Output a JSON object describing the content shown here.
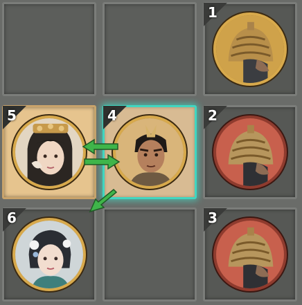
{
  "board": {
    "slots": [
      {
        "number": "1",
        "unit": "helmeted-soldier",
        "frame": "gold"
      },
      {
        "number": "2",
        "unit": "helmeted-soldier",
        "frame": "red"
      },
      {
        "number": "3",
        "unit": "helmeted-soldier",
        "frame": "red"
      },
      {
        "number": "4",
        "unit": "warrior-hero",
        "frame": "gold",
        "state": "selected"
      },
      {
        "number": "5",
        "unit": "lady-with-fan",
        "frame": "gold",
        "state": "swap-target"
      },
      {
        "number": "6",
        "unit": "lady-with-flowers",
        "frame": "gold"
      }
    ],
    "colors": {
      "selection_glow": "#41d6c0",
      "move_arrow": "#3fb54a",
      "frame_gold": "#d7a94c",
      "frame_red": "#c8604d"
    }
  }
}
